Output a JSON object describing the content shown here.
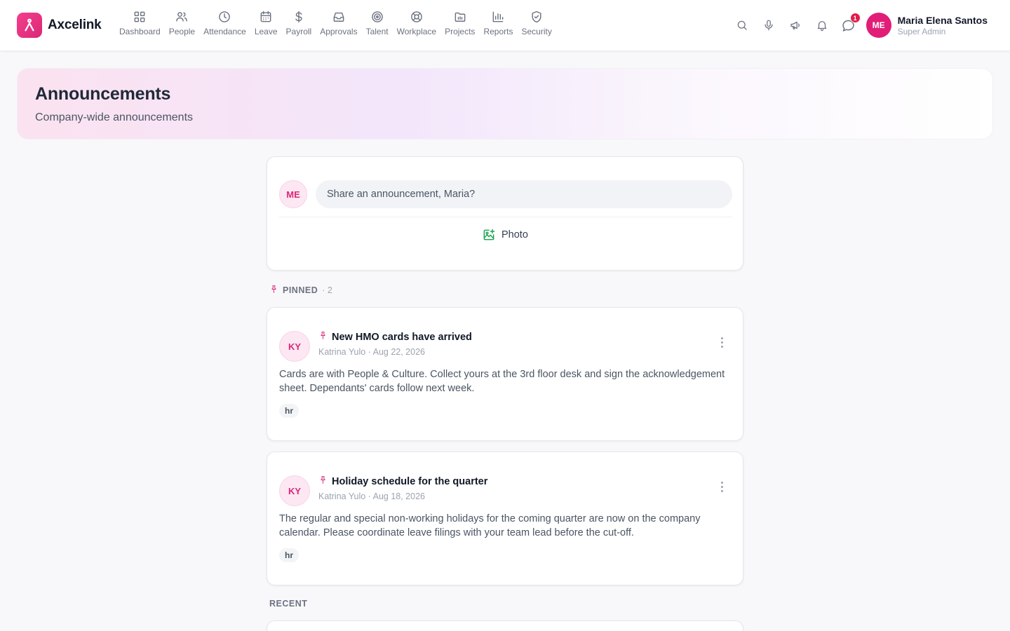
{
  "app": {
    "name": "Axcelink"
  },
  "nav": [
    {
      "label": "Dashboard",
      "icon": "dashboard-icon"
    },
    {
      "label": "People",
      "icon": "people-icon"
    },
    {
      "label": "Attendance",
      "icon": "clock-icon"
    },
    {
      "label": "Leave",
      "icon": "calendar-icon"
    },
    {
      "label": "Payroll",
      "icon": "dollar-icon"
    },
    {
      "label": "Approvals",
      "icon": "inbox-icon"
    },
    {
      "label": "Talent",
      "icon": "target-icon"
    },
    {
      "label": "Workplace",
      "icon": "lifebuoy-icon"
    },
    {
      "label": "Projects",
      "icon": "folder-icon"
    },
    {
      "label": "Reports",
      "icon": "bar-chart-icon"
    },
    {
      "label": "Security",
      "icon": "shield-icon"
    }
  ],
  "header": {
    "chat_badge": "1",
    "user": {
      "initials": "ME",
      "name": "Maria Elena Santos",
      "role": "Super Admin"
    }
  },
  "hero": {
    "title": "Announcements",
    "subtitle": "Company-wide announcements"
  },
  "composer": {
    "avatar": "ME",
    "placeholder": "Share an announcement, Maria?",
    "photo_label": "Photo"
  },
  "pinned": {
    "label": "PINNED",
    "count": "· 2"
  },
  "posts": [
    {
      "avatar": "KY",
      "title": "New HMO cards have arrived",
      "meta": "Katrina Yulo · Aug 22, 2026",
      "body": "Cards are with People & Culture. Collect yours at the 3rd floor desk and sign the acknowledgement sheet. Dependants' cards follow next week.",
      "tag": "hr"
    },
    {
      "avatar": "KY",
      "title": "Holiday schedule for the quarter",
      "meta": "Katrina Yulo · Aug 18, 2026",
      "body": "The regular and special non-working holidays for the coming quarter are now on the company calendar. Please coordinate leave filings with your team lead before the cut-off.",
      "tag": "hr"
    }
  ],
  "recent": {
    "label": "RECENT"
  },
  "colors": {
    "brand": "#db2777",
    "accent": "#e11d78",
    "photo": "#16a34a",
    "badge": "#e11d48"
  }
}
